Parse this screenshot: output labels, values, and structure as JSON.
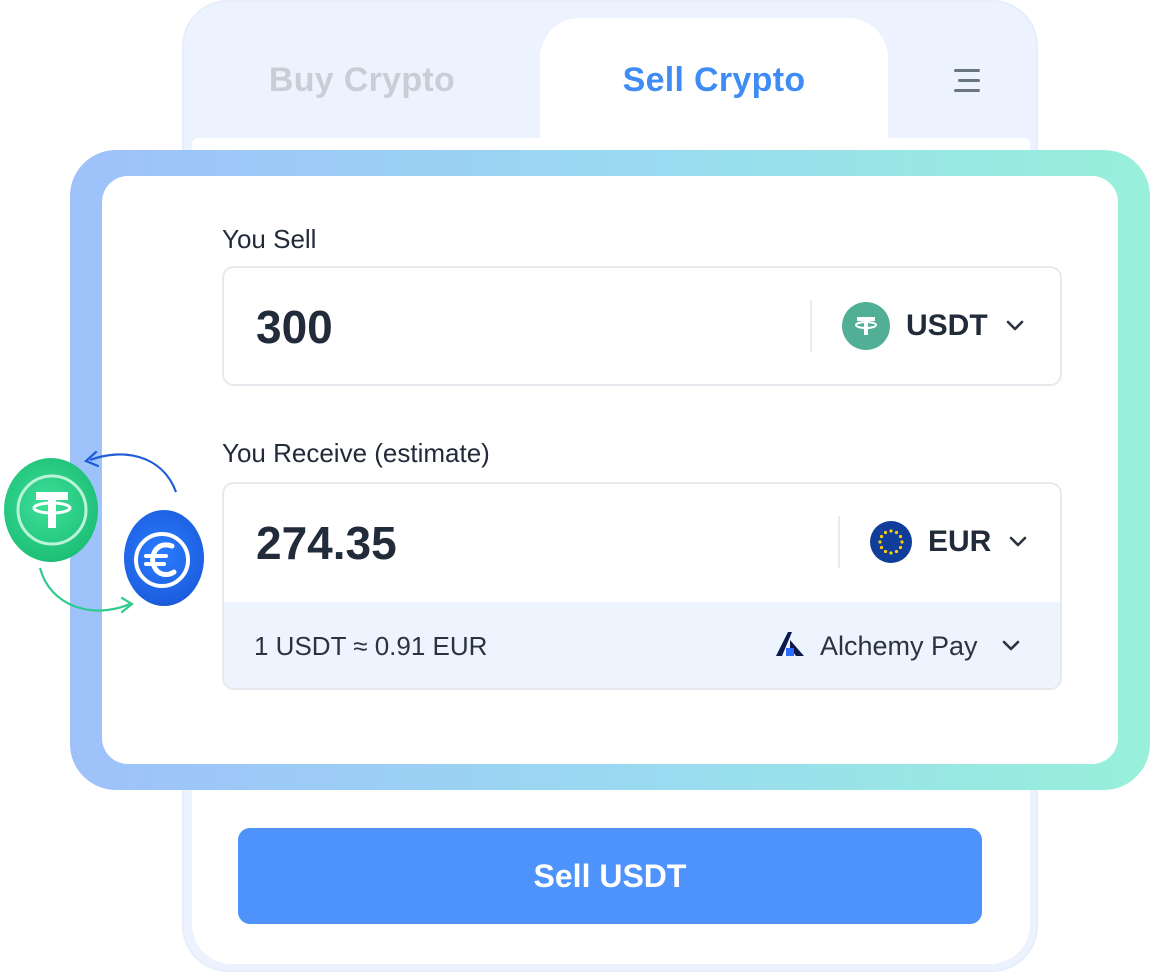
{
  "tabs": {
    "buy_label": "Buy Crypto",
    "sell_label": "Sell Crypto",
    "active": "sell"
  },
  "sell": {
    "label": "You Sell",
    "amount": "300",
    "currency": "USDT"
  },
  "receive": {
    "label": "You Receive (estimate)",
    "amount": "274.35",
    "currency": "EUR"
  },
  "rate": {
    "text": "1 USDT ≈ 0.91 EUR"
  },
  "provider": {
    "name": "Alchemy Pay"
  },
  "action": {
    "button_label": "Sell USDT"
  },
  "colors": {
    "accent": "#4d93fb",
    "tether": "#50af95",
    "euro": "#0f3d99",
    "inactive_tab": "#c9ced6"
  },
  "icons": [
    "menu-icon",
    "tether-icon",
    "euro-flag-icon",
    "chevron-down-icon",
    "alchemy-pay-logo",
    "tether-coin-icon",
    "euro-coin-icon",
    "swap-arrows-icon"
  ]
}
